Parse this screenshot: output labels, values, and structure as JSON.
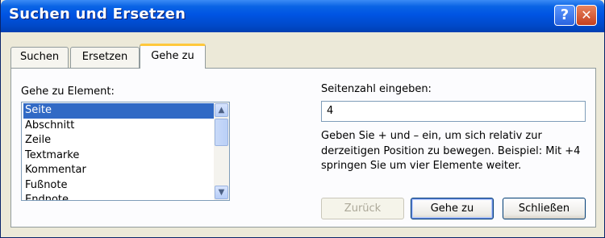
{
  "window": {
    "title": "Suchen und Ersetzen",
    "help_glyph": "?",
    "close_glyph": "✕"
  },
  "tabs": [
    {
      "label": "Suchen"
    },
    {
      "label": "Ersetzen"
    },
    {
      "label": "Gehe zu",
      "active": true
    }
  ],
  "goto": {
    "element_label": "Gehe zu Element:",
    "elements": [
      "Seite",
      "Abschnitt",
      "Zeile",
      "Textmarke",
      "Kommentar",
      "Fußnote",
      "Endnote"
    ],
    "selected_element": "Seite",
    "scroll_up_glyph": "▲",
    "scroll_down_glyph": "▼",
    "page_number_label": "Seitenzahl eingeben:",
    "page_number_value": "4",
    "help_lines": [
      "Geben Sie + und – ein, um sich relativ zur",
      "derzeitigen Position zu bewegen. Beispiel: Mit +4",
      "springen Sie um vier Elemente weiter."
    ]
  },
  "buttons": {
    "back": "Zurück",
    "goto": "Gehe zu",
    "close": "Schließen"
  },
  "colors": {
    "titlebar": "#0054e3",
    "selection": "#316ac5",
    "active_tab_accent": "#ffc83c",
    "dialog_bg": "#ece9d8"
  }
}
